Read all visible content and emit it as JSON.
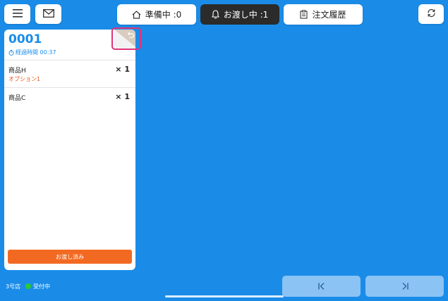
{
  "toolbar": {
    "menu_icon": "hamburger-menu-icon",
    "mail_icon": "envelope-icon",
    "refresh_icon": "refresh-icon"
  },
  "tabs": [
    {
      "label": "準備中 :0",
      "icon": "home-icon",
      "active": false
    },
    {
      "label": "お渡し中 :1",
      "icon": "bell-icon",
      "active": true
    },
    {
      "label": "注文履歴",
      "icon": "clipboard-icon",
      "active": false
    }
  ],
  "order": {
    "number": "0001",
    "elapsed_label": "経過時間 00:37",
    "items": [
      {
        "name": "商品H",
        "option": "オプション1",
        "qty": "× 1"
      },
      {
        "name": "商品C",
        "option": "",
        "qty": "× 1"
      }
    ],
    "done_button": "お渡し済み",
    "undo_icon": "undo-icon"
  },
  "footer": {
    "store": "3号店",
    "status": "受付中",
    "status_color": "#2ec92e"
  },
  "pagination": {
    "first_icon": "first-page-icon",
    "last_icon": "last-page-icon"
  },
  "colors": {
    "background": "#1a8ce8",
    "accent_orange": "#f26a22",
    "highlight": "#e0337a"
  }
}
